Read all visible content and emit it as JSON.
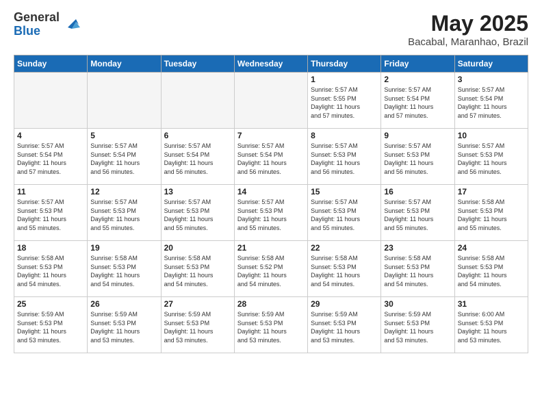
{
  "logo": {
    "general": "General",
    "blue": "Blue"
  },
  "header": {
    "month_year": "May 2025",
    "location": "Bacabal, Maranhao, Brazil"
  },
  "weekdays": [
    "Sunday",
    "Monday",
    "Tuesday",
    "Wednesday",
    "Thursday",
    "Friday",
    "Saturday"
  ],
  "weeks": [
    [
      {
        "num": "",
        "info": ""
      },
      {
        "num": "",
        "info": ""
      },
      {
        "num": "",
        "info": ""
      },
      {
        "num": "",
        "info": ""
      },
      {
        "num": "1",
        "info": "Sunrise: 5:57 AM\nSunset: 5:55 PM\nDaylight: 11 hours\nand 57 minutes."
      },
      {
        "num": "2",
        "info": "Sunrise: 5:57 AM\nSunset: 5:54 PM\nDaylight: 11 hours\nand 57 minutes."
      },
      {
        "num": "3",
        "info": "Sunrise: 5:57 AM\nSunset: 5:54 PM\nDaylight: 11 hours\nand 57 minutes."
      }
    ],
    [
      {
        "num": "4",
        "info": "Sunrise: 5:57 AM\nSunset: 5:54 PM\nDaylight: 11 hours\nand 57 minutes."
      },
      {
        "num": "5",
        "info": "Sunrise: 5:57 AM\nSunset: 5:54 PM\nDaylight: 11 hours\nand 56 minutes."
      },
      {
        "num": "6",
        "info": "Sunrise: 5:57 AM\nSunset: 5:54 PM\nDaylight: 11 hours\nand 56 minutes."
      },
      {
        "num": "7",
        "info": "Sunrise: 5:57 AM\nSunset: 5:54 PM\nDaylight: 11 hours\nand 56 minutes."
      },
      {
        "num": "8",
        "info": "Sunrise: 5:57 AM\nSunset: 5:53 PM\nDaylight: 11 hours\nand 56 minutes."
      },
      {
        "num": "9",
        "info": "Sunrise: 5:57 AM\nSunset: 5:53 PM\nDaylight: 11 hours\nand 56 minutes."
      },
      {
        "num": "10",
        "info": "Sunrise: 5:57 AM\nSunset: 5:53 PM\nDaylight: 11 hours\nand 56 minutes."
      }
    ],
    [
      {
        "num": "11",
        "info": "Sunrise: 5:57 AM\nSunset: 5:53 PM\nDaylight: 11 hours\nand 55 minutes."
      },
      {
        "num": "12",
        "info": "Sunrise: 5:57 AM\nSunset: 5:53 PM\nDaylight: 11 hours\nand 55 minutes."
      },
      {
        "num": "13",
        "info": "Sunrise: 5:57 AM\nSunset: 5:53 PM\nDaylight: 11 hours\nand 55 minutes."
      },
      {
        "num": "14",
        "info": "Sunrise: 5:57 AM\nSunset: 5:53 PM\nDaylight: 11 hours\nand 55 minutes."
      },
      {
        "num": "15",
        "info": "Sunrise: 5:57 AM\nSunset: 5:53 PM\nDaylight: 11 hours\nand 55 minutes."
      },
      {
        "num": "16",
        "info": "Sunrise: 5:57 AM\nSunset: 5:53 PM\nDaylight: 11 hours\nand 55 minutes."
      },
      {
        "num": "17",
        "info": "Sunrise: 5:58 AM\nSunset: 5:53 PM\nDaylight: 11 hours\nand 55 minutes."
      }
    ],
    [
      {
        "num": "18",
        "info": "Sunrise: 5:58 AM\nSunset: 5:53 PM\nDaylight: 11 hours\nand 54 minutes."
      },
      {
        "num": "19",
        "info": "Sunrise: 5:58 AM\nSunset: 5:53 PM\nDaylight: 11 hours\nand 54 minutes."
      },
      {
        "num": "20",
        "info": "Sunrise: 5:58 AM\nSunset: 5:53 PM\nDaylight: 11 hours\nand 54 minutes."
      },
      {
        "num": "21",
        "info": "Sunrise: 5:58 AM\nSunset: 5:52 PM\nDaylight: 11 hours\nand 54 minutes."
      },
      {
        "num": "22",
        "info": "Sunrise: 5:58 AM\nSunset: 5:53 PM\nDaylight: 11 hours\nand 54 minutes."
      },
      {
        "num": "23",
        "info": "Sunrise: 5:58 AM\nSunset: 5:53 PM\nDaylight: 11 hours\nand 54 minutes."
      },
      {
        "num": "24",
        "info": "Sunrise: 5:58 AM\nSunset: 5:53 PM\nDaylight: 11 hours\nand 54 minutes."
      }
    ],
    [
      {
        "num": "25",
        "info": "Sunrise: 5:59 AM\nSunset: 5:53 PM\nDaylight: 11 hours\nand 53 minutes."
      },
      {
        "num": "26",
        "info": "Sunrise: 5:59 AM\nSunset: 5:53 PM\nDaylight: 11 hours\nand 53 minutes."
      },
      {
        "num": "27",
        "info": "Sunrise: 5:59 AM\nSunset: 5:53 PM\nDaylight: 11 hours\nand 53 minutes."
      },
      {
        "num": "28",
        "info": "Sunrise: 5:59 AM\nSunset: 5:53 PM\nDaylight: 11 hours\nand 53 minutes."
      },
      {
        "num": "29",
        "info": "Sunrise: 5:59 AM\nSunset: 5:53 PM\nDaylight: 11 hours\nand 53 minutes."
      },
      {
        "num": "30",
        "info": "Sunrise: 5:59 AM\nSunset: 5:53 PM\nDaylight: 11 hours\nand 53 minutes."
      },
      {
        "num": "31",
        "info": "Sunrise: 6:00 AM\nSunset: 5:53 PM\nDaylight: 11 hours\nand 53 minutes."
      }
    ]
  ]
}
